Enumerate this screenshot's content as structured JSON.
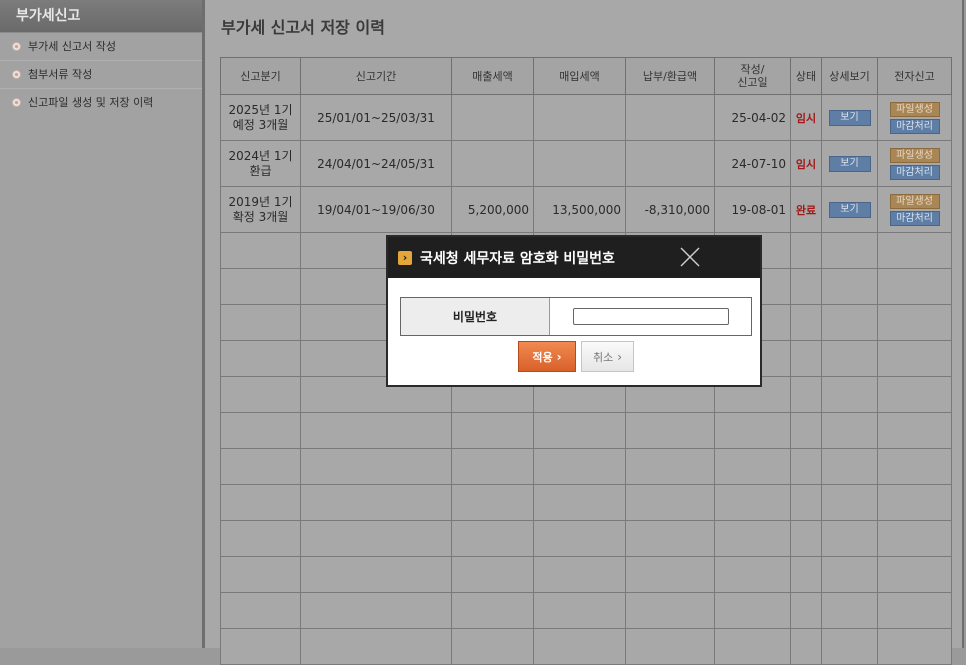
{
  "sidebar": {
    "title": "부가세신고",
    "items": [
      {
        "label": "부가세 신고서 작성"
      },
      {
        "label": "첨부서류 작성"
      },
      {
        "label": "신고파일 생성 및 저장 이력"
      }
    ]
  },
  "main": {
    "title": "부가세 신고서 저장 이력",
    "columns": [
      "신고분기",
      "신고기간",
      "매출세액",
      "매입세액",
      "납부/환급액",
      "작성/\n신고일",
      "상태",
      "상세보기",
      "전자신고"
    ],
    "rows": [
      {
        "quarter_line1": "2025년 1기",
        "quarter_line2": "예정 3개월",
        "period": "25/01/01~25/03/31",
        "sales_tax": "",
        "purchase_tax": "",
        "net_amount": "",
        "date": "25-04-02",
        "status": "임시",
        "view_label": "보기",
        "file_label": "파일생성",
        "close_label": "마감처리"
      },
      {
        "quarter_line1": "2024년 1기",
        "quarter_line2": "환급",
        "period": "24/04/01~24/05/31",
        "sales_tax": "",
        "purchase_tax": "",
        "net_amount": "",
        "date": "24-07-10",
        "status": "임시",
        "view_label": "보기",
        "file_label": "파일생성",
        "close_label": "마감처리"
      },
      {
        "quarter_line1": "2019년 1기",
        "quarter_line2": "확정 3개월",
        "period": "19/04/01~19/06/30",
        "sales_tax": "5,200,000",
        "purchase_tax": "13,500,000",
        "net_amount": "-8,310,000",
        "date": "19-08-01",
        "status": "완료",
        "view_label": "보기",
        "file_label": "파일생성",
        "close_label": "마감처리"
      }
    ]
  },
  "modal": {
    "title": "국세청 세무자료 암호화 비밀번호",
    "password_label": "비밀번호",
    "password_value": "",
    "apply_label": "적용",
    "cancel_label": "취소"
  },
  "colors": {
    "accent_orange": "#e0703a",
    "status_red": "#a01818",
    "button_blue": "#5e7ea6",
    "button_brown": "#a98656"
  }
}
